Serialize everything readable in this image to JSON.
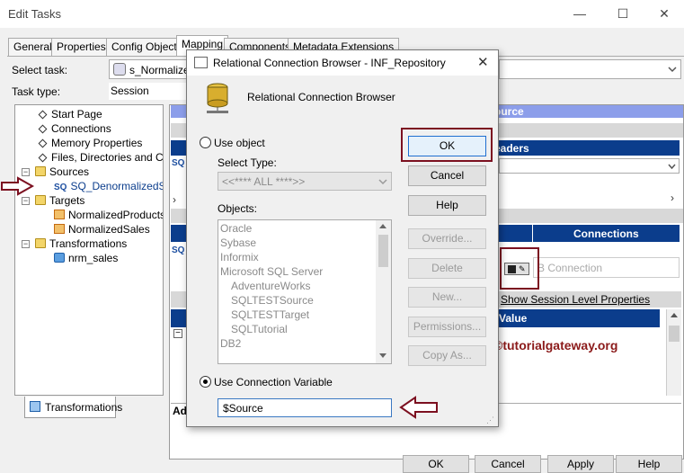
{
  "window": {
    "title": "Edit Tasks",
    "minimize_glyph": "—",
    "maximize_glyph": "☐",
    "close_glyph": "✕"
  },
  "tabs": [
    "General",
    "Properties",
    "Config Object",
    "Mapping",
    "Components",
    "Metadata Extensions"
  ],
  "task": {
    "select_task_label": "Select task:",
    "select_task_value": "s_Normalizer",
    "task_type_label": "Task type:",
    "task_type_value": "Session"
  },
  "tree": {
    "start_page": "Start Page",
    "connections": "Connections",
    "memory_properties": "Memory Properties",
    "files": "Files, Directories and Com",
    "sources": "Sources",
    "sq": "SQ_DenormalizedSour",
    "targets": "Targets",
    "target1": "NormalizedProducts",
    "target2": "NormalizedSales",
    "transformations": "Transformations",
    "nrm": "nrm_sales",
    "bottom_tab": "Transformations",
    "sq_badge": "SQ"
  },
  "right_panel": {
    "source_header": "ource",
    "readers_header": "eaders",
    "connections_header": "Connections",
    "db_connection_placeholder": "B Connection",
    "show_session_link": "Show Session Level Properties",
    "value_header": "Value",
    "ad_label": "Ad",
    "sq_badge": "SQ"
  },
  "dialog": {
    "title": "Relational Connection Browser - INF_Repository",
    "heading": "Relational Connection Browser",
    "use_object_label": "Use object",
    "select_type_label": "Select Type:",
    "select_type_value": "<<**** ALL ****>>",
    "objects_label": "Objects:",
    "objects": [
      "Oracle",
      "Sybase",
      "Informix",
      "Microsoft SQL Server",
      "AdventureWorks",
      "SQLTESTSource",
      "SQLTESTTarget",
      "SQLTutorial",
      "DB2"
    ],
    "use_connection_variable_label": "Use Connection Variable",
    "connection_variable_value": "$Source",
    "buttons": {
      "ok": "OK",
      "cancel": "Cancel",
      "help": "Help",
      "override": "Override...",
      "delete": "Delete",
      "new": "New...",
      "permissions": "Permissions...",
      "copy_as": "Copy As..."
    }
  },
  "watermark": "©tutorialgateway.org",
  "bottom_buttons": {
    "ok": "OK",
    "cancel": "Cancel",
    "apply": "Apply",
    "help": "Help"
  },
  "colors": {
    "navy": "#0b3d8c",
    "annotation_red": "#7c1020",
    "watermark": "#8b1a1a"
  }
}
